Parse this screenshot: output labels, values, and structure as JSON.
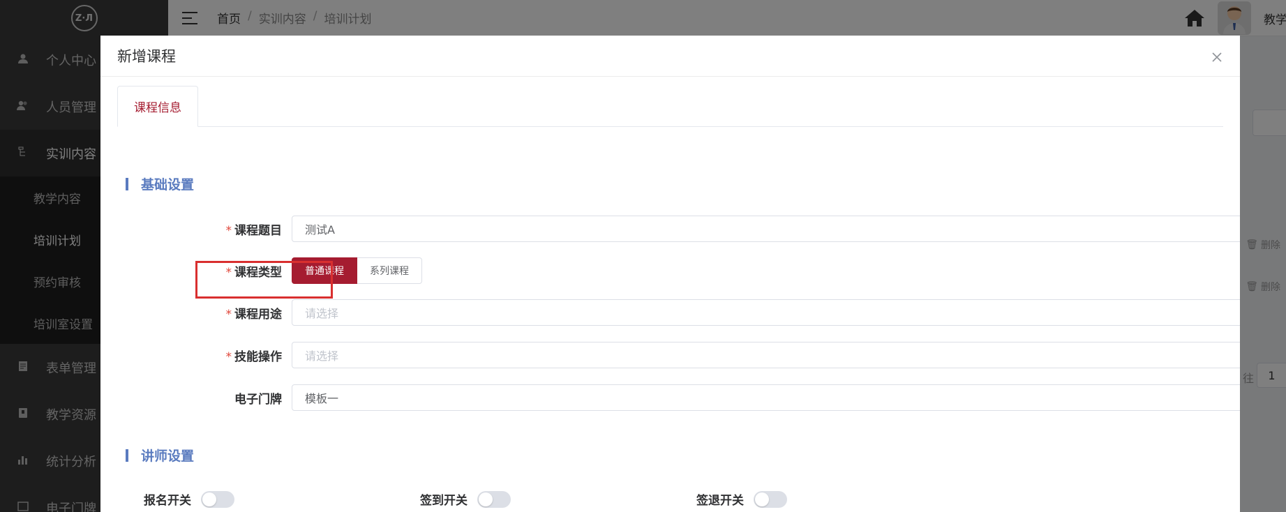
{
  "sidebar": {
    "logo_text": "Z·Л",
    "items": [
      {
        "label": "个人中心",
        "icon": "user-icon"
      },
      {
        "label": "人员管理",
        "icon": "users-icon"
      },
      {
        "label": "实训内容",
        "icon": "tree-icon"
      },
      {
        "label": "表单管理",
        "icon": "form-icon"
      },
      {
        "label": "教学资源",
        "icon": "book-icon"
      },
      {
        "label": "统计分析",
        "icon": "bar-chart-icon"
      },
      {
        "label": "电子门牌",
        "icon": "board-icon"
      }
    ],
    "submenu": [
      {
        "label": "教学内容"
      },
      {
        "label": "培训计划"
      },
      {
        "label": "预约审核"
      },
      {
        "label": "培训室设置"
      }
    ]
  },
  "header": {
    "breadcrumb": [
      "首页",
      "实训内容",
      "培训计划"
    ],
    "breadcrumb_sep": "/",
    "user_name": "教学"
  },
  "background": {
    "delete_label": "删除",
    "page_prefix": "往",
    "page_number": "1"
  },
  "dialog": {
    "title": "新增课程",
    "close_icon": "close-icon",
    "tab_label": "课程信息",
    "section_basic": "基础设置",
    "section_lecturer": "讲师设置",
    "fields": {
      "course_title": {
        "label": "课程题目",
        "value": "测试A"
      },
      "course_type": {
        "label": "课程类型",
        "options": [
          "普通课程",
          "系列课程"
        ],
        "selected": "普通课程"
      },
      "course_usage": {
        "label": "课程用途",
        "placeholder": "请选择"
      },
      "skill_operation": {
        "label": "技能操作",
        "placeholder": "请选择"
      },
      "e_doorplate": {
        "label": "电子门牌",
        "value": "模板一"
      }
    },
    "switches": {
      "signup": {
        "label": "报名开关",
        "on": false
      },
      "checkin": {
        "label": "签到开关",
        "on": false
      },
      "checkout": {
        "label": "签退开关",
        "on": false
      }
    }
  },
  "colors": {
    "accent": "#a51c30",
    "section": "#5a7bbf",
    "highlight": "#d92f2f",
    "required": "#e0473b"
  }
}
